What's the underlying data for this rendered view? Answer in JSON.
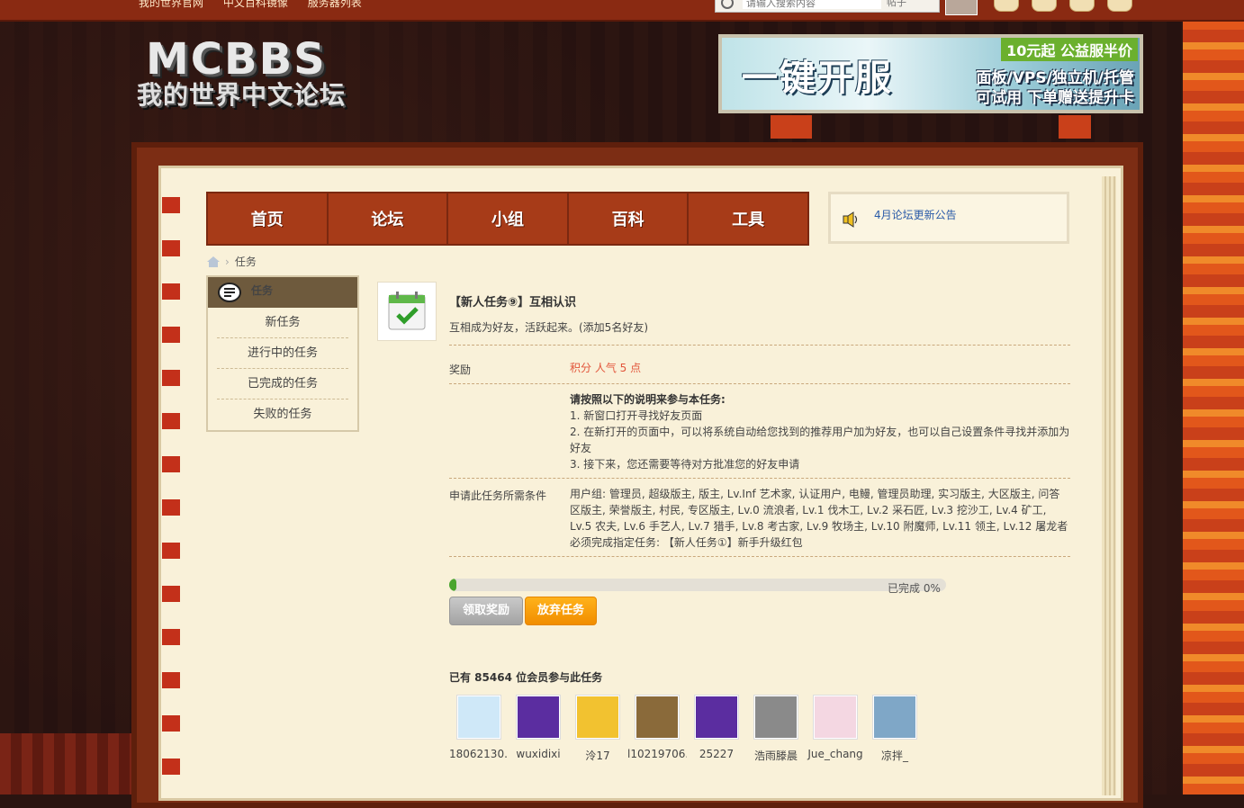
{
  "topbar": {
    "links": [
      "我的世界官网",
      "中文百科镜像",
      "服务器列表"
    ],
    "search_placeholder": "请输入搜索内容",
    "search_scope": "帖子"
  },
  "logo": {
    "title": "MCBBS",
    "subtitle": "我的世界中文论坛"
  },
  "ad": {
    "main": "一键开服",
    "tag": "10元起 公益服半价",
    "line1": "面板/VPS/独立机/托管",
    "line2": "可试用 下单赠送提升卡"
  },
  "nav": {
    "items": [
      "首页",
      "论坛",
      "小组",
      "百科",
      "工具"
    ]
  },
  "notice": {
    "link": "4月论坛更新公告"
  },
  "breadcrumb": {
    "current": "任务"
  },
  "sidebar": {
    "title": "任务",
    "items": [
      "新任务",
      "进行中的任务",
      "已完成的任务",
      "失败的任务"
    ]
  },
  "task": {
    "title": "【新人任务⑨】互相认识",
    "description": "互相成为好友，活跃起来。(添加5名好友)",
    "reward_label": "奖励",
    "reward_value": "积分 人气 5 点",
    "instructions_head": "请按照以下的说明来参与本任务:",
    "instructions": [
      "1. 新窗口打开寻找好友页面",
      "2. 在新打开的页面中，可以将系统自动给您找到的推荐用户加为好友，也可以自己设置条件寻找并添加为好友",
      "3. 接下来，您还需要等待对方批准您的好友申请"
    ],
    "requirements_label": "申请此任务所需条件",
    "requirements_groups": "用户组: 管理员, 超级版主, 版主, Lv.Inf 艺术家, 认证用户, 电鳗, 管理员助理, 实习版主, 大区版主, 问答区版主, 荣誉版主, 村民, 专区版主, Lv.0 流浪者, Lv.1 伐木工, Lv.2 采石匠, Lv.3 挖沙工, Lv.4 矿工, Lv.5 农夫, Lv.6 手艺人, Lv.7 猎手, Lv.8 考古家, Lv.9 牧场主, Lv.10 附魔师, Lv.11 领主, Lv.12 屠龙者",
    "requirements_task": "必须完成指定任务: 【新人任务①】新手升级红包",
    "progress_text": "已完成 0%",
    "progress_fraction": 0.014,
    "claim_button": "领取奖励",
    "abandon_button": "放弃任务",
    "members_title": "已有 85464 位会员参与此任务",
    "members": [
      {
        "name": "18062130...",
        "color": "#cfe8f8"
      },
      {
        "name": "wuxidixi",
        "color": "#5b2da0"
      },
      {
        "name": "泠17",
        "color": "#f2c230"
      },
      {
        "name": "l10219706...",
        "color": "#8a6a3a"
      },
      {
        "name": "25227",
        "color": "#5b2da0"
      },
      {
        "name": "浩雨滕晨",
        "color": "#8a8a8a"
      },
      {
        "name": "Jue_chang",
        "color": "#f4d7e2"
      },
      {
        "name": "凉拌_",
        "color": "#7fa7c7"
      }
    ]
  },
  "colors": {
    "nav_bg": "#a73b18",
    "paper": "#f9f1d9",
    "reward": "#e2553a",
    "progress": "#4aa52f",
    "abandon": "#f18d00",
    "link": "#2a5ba8"
  }
}
